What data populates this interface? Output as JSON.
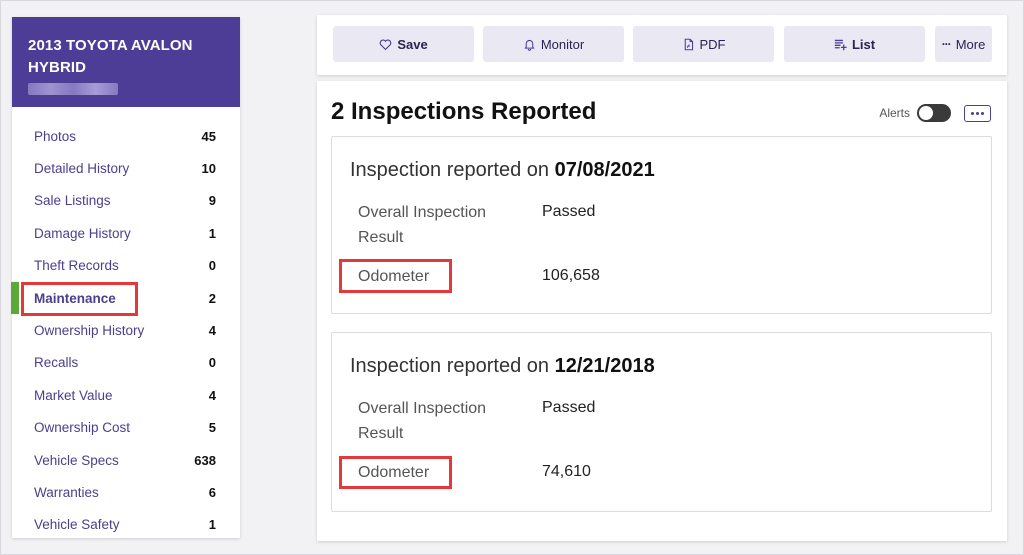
{
  "vehicle": {
    "title": "2013 TOYOTA AVALON HYBRID"
  },
  "sidebar": {
    "items": [
      {
        "label": "Photos",
        "count": "45"
      },
      {
        "label": "Detailed History",
        "count": "10"
      },
      {
        "label": "Sale Listings",
        "count": "9"
      },
      {
        "label": "Damage History",
        "count": "1"
      },
      {
        "label": "Theft Records",
        "count": "0"
      },
      {
        "label": "Maintenance",
        "count": "2"
      },
      {
        "label": "Ownership History",
        "count": "4"
      },
      {
        "label": "Recalls",
        "count": "0"
      },
      {
        "label": "Market Value",
        "count": "4"
      },
      {
        "label": "Ownership Cost",
        "count": "5"
      },
      {
        "label": "Vehicle Specs",
        "count": "638"
      },
      {
        "label": "Warranties",
        "count": "6"
      },
      {
        "label": "Vehicle Safety",
        "count": "1"
      }
    ],
    "active": "Maintenance"
  },
  "toolbar": {
    "save": "Save",
    "monitor": "Monitor",
    "pdf": "PDF",
    "list": "List",
    "more": "More"
  },
  "main": {
    "title": "2 Inspections Reported",
    "alerts_label": "Alerts",
    "inspections": [
      {
        "prefix": "Inspection reported on ",
        "date": "07/08/2021",
        "result_label_1": "Overall Inspection",
        "result_label_2": "Result",
        "result_value": "Passed",
        "odometer_label": "Odometer",
        "odometer_value": "106,658"
      },
      {
        "prefix": "Inspection reported on ",
        "date": "12/21/2018",
        "result_label_1": "Overall Inspection",
        "result_label_2": "Result",
        "result_value": "Passed",
        "odometer_label": "Odometer",
        "odometer_value": "74,610"
      }
    ]
  },
  "colors": {
    "brand": "#4e3d96",
    "active_indicator": "#5aaa3a",
    "highlight": "#e5383b"
  }
}
